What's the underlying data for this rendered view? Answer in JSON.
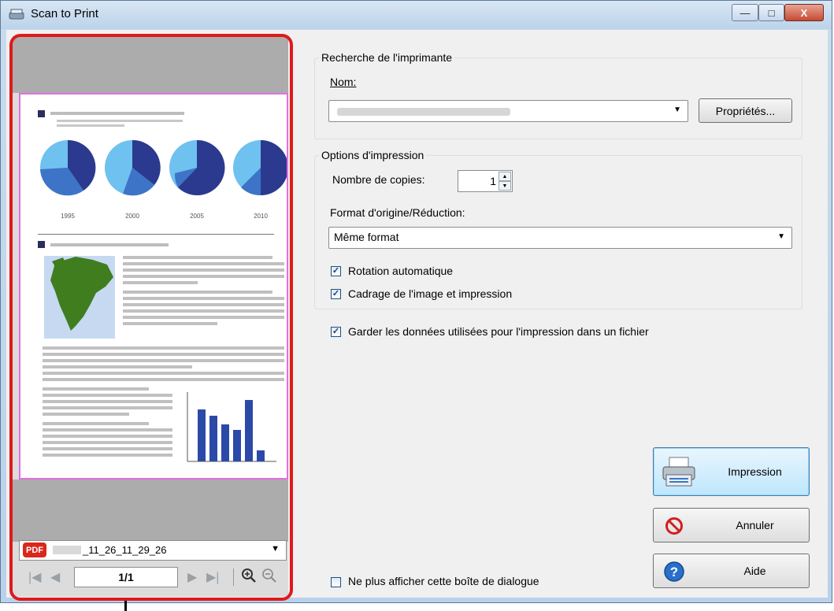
{
  "window": {
    "title": "Scan to Print",
    "min_glyph": "—",
    "max_glyph": "□",
    "close_glyph": "X"
  },
  "preview": {
    "chart_years": [
      "1995",
      "2000",
      "2005",
      "2010"
    ],
    "file_badge": "PDF",
    "file_name": "_11_26_11_29_26",
    "page_indicator": "1/1"
  },
  "printer_group": {
    "title": "Recherche de l'imprimante",
    "name_label": "Nom:",
    "properties_button": "Propriétés..."
  },
  "print_options": {
    "title": "Options d'impression",
    "copies_label": "Nombre de copies:",
    "copies_value": "1",
    "format_label": "Format d'origine/Réduction:",
    "format_value": "Même format",
    "auto_rotation": "Rotation automatique",
    "auto_rotation_checked": true,
    "crop_print": "Cadrage de l'image et impression",
    "crop_print_checked": true
  },
  "keep_data": {
    "label": "Garder les données utilisées pour l'impression dans un fichier",
    "checked": true
  },
  "dont_show": {
    "label": "Ne plus afficher cette boîte de dialogue",
    "checked": false
  },
  "buttons": {
    "print": "Impression",
    "cancel": "Annuler",
    "help": "Aide"
  },
  "colors": {
    "highlight": "#e0191a",
    "pie_dark": "#2b3a8f",
    "pie_light": "#6fc1ef",
    "map_land": "#3f7d1f",
    "map_sea": "#c6d9f1",
    "bar": "#2b4aa8"
  }
}
